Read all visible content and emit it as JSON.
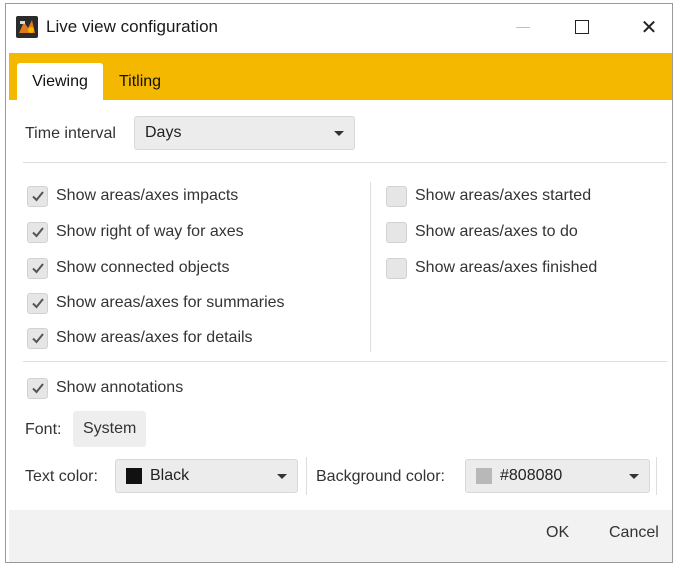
{
  "window": {
    "title": "Live view configuration",
    "icon": "app-logo-icon",
    "controls": {
      "minimize": "minimize-icon",
      "maximize": "maximize-icon",
      "close": "close-icon",
      "close_glyph": "✕"
    }
  },
  "tabs": [
    {
      "label": "Viewing",
      "active": true
    },
    {
      "label": "Titling",
      "active": false
    }
  ],
  "accent_color": "#f5b800",
  "time_interval": {
    "label": "Time interval",
    "value": "Days"
  },
  "left_checks": [
    {
      "label": "Show areas/axes impacts",
      "checked": true
    },
    {
      "label": "Show right of way for axes",
      "checked": true
    },
    {
      "label": "Show connected objects",
      "checked": true
    },
    {
      "label": "Show areas/axes for summaries",
      "checked": true
    },
    {
      "label": "Show areas/axes for details",
      "checked": true
    }
  ],
  "right_checks": [
    {
      "label": "Show areas/axes started",
      "checked": false
    },
    {
      "label": "Show areas/axes to do",
      "checked": false
    },
    {
      "label": "Show areas/axes finished",
      "checked": false
    }
  ],
  "annotations": {
    "label": "Show annotations",
    "checked": true
  },
  "font": {
    "label": "Font:",
    "value": "System"
  },
  "text_color": {
    "label": "Text color:",
    "value": "Black",
    "swatch": "#111111"
  },
  "background_color": {
    "label": "Background color:",
    "value": "#808080",
    "swatch": "#b8b8b8"
  },
  "footer": {
    "ok": "OK",
    "cancel": "Cancel"
  }
}
